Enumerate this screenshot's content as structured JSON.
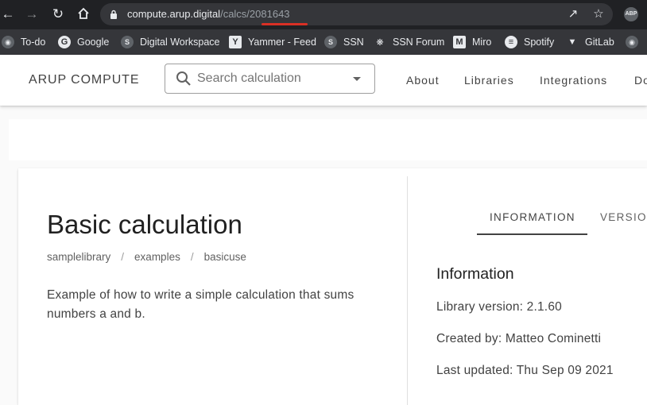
{
  "browser": {
    "url_host": "compute.arup.digital",
    "url_path": "/calcs/2081643",
    "extension_badge": "ABP"
  },
  "bookmarks": [
    {
      "label": "To-do",
      "icon": "github-icon"
    },
    {
      "label": "Google",
      "icon": "google-icon"
    },
    {
      "label": "Digital Workspace",
      "icon": "sharepoint-icon"
    },
    {
      "label": "Yammer - Feed",
      "icon": "yammer-icon"
    },
    {
      "label": "SSN",
      "icon": "sharepoint-icon"
    },
    {
      "label": "SSN Forum",
      "icon": "slack-icon"
    },
    {
      "label": "Miro",
      "icon": "miro-icon"
    },
    {
      "label": "Spotify",
      "icon": "spotify-icon"
    },
    {
      "label": "GitLab",
      "icon": "gitlab-icon"
    }
  ],
  "header": {
    "brand": "ARUP  COMPUTE",
    "search_placeholder": "Search calculation",
    "nav": [
      "About",
      "Libraries",
      "Integrations",
      "Do"
    ]
  },
  "calc": {
    "title": "Basic calculation",
    "breadcrumb": [
      "samplelibrary",
      "examples",
      "basicuse"
    ],
    "breadcrumb_separator": "/",
    "description": "Example of how to write a simple calculation that sums numbers a and b."
  },
  "tabs": [
    {
      "label": "INFORMATION",
      "active": true
    },
    {
      "label": "VERSIONS",
      "active": false
    }
  ],
  "info": {
    "heading": "Information",
    "library_version": "Library version: 2.1.60",
    "created_by": "Created by: Matteo Cominetti",
    "last_updated": "Last updated: Thu Sep 09 2021"
  },
  "colors": {
    "chrome_dark": "#202124",
    "bookmarks_bar": "#35363a",
    "url_highlight": "#d93025",
    "text_primary": "#212121"
  }
}
